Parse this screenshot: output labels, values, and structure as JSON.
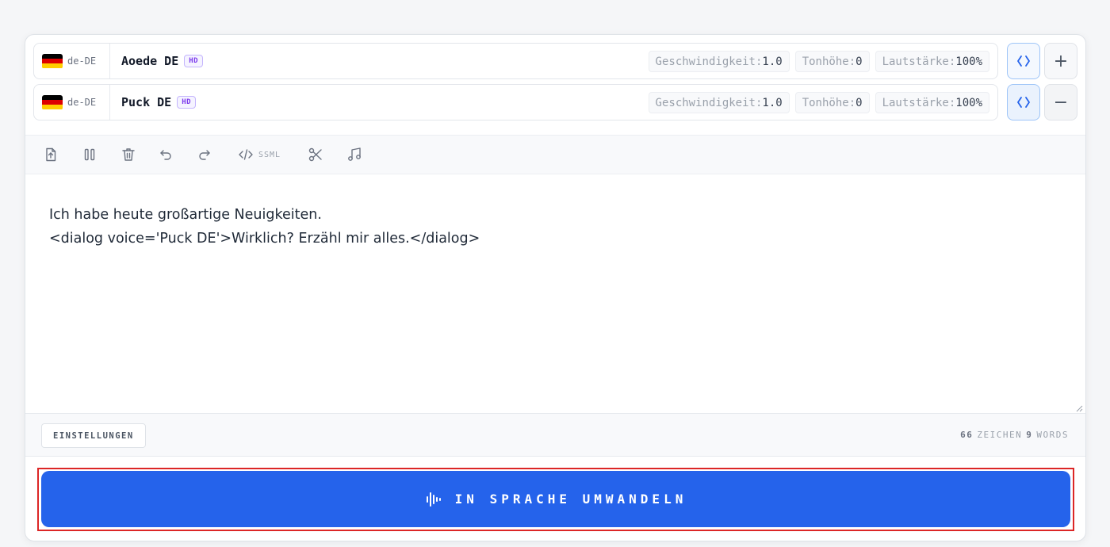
{
  "voices": [
    {
      "lang": "de-DE",
      "name": "Aoede DE",
      "badge": "HD",
      "speed_label": "Geschwindigkeit:",
      "speed_value": "1.0",
      "pitch_label": "Tonhöhe:",
      "pitch_value": "0",
      "volume_label": "Lautstärke:",
      "volume_value": "100%",
      "action": "+"
    },
    {
      "lang": "de-DE",
      "name": "Puck DE",
      "badge": "HD",
      "speed_label": "Geschwindigkeit:",
      "speed_value": "1.0",
      "pitch_label": "Tonhöhe:",
      "pitch_value": "0",
      "volume_label": "Lautstärke:",
      "volume_value": "100%",
      "action": "−"
    }
  ],
  "toolbar": {
    "ssml_label": "SSML",
    "icons": [
      "upload-icon",
      "pause-icon",
      "trash-icon",
      "undo-icon",
      "redo-icon",
      "code-icon",
      "scissors-icon",
      "music-icon"
    ]
  },
  "editor": {
    "text": "Ich habe heute großartige Neuigkeiten.\n<dialog voice='Puck DE'>Wirklich? Erzähl mir alles.</dialog>"
  },
  "footer": {
    "settings_label": "EINSTELLUNGEN",
    "char_count": "66",
    "char_label": "ZEICHEN",
    "word_count": "9",
    "word_label": "WORDS"
  },
  "convert": {
    "label": "IN SPRACHE UMWANDELN"
  },
  "colors": {
    "accent": "#2563eb",
    "focus": "#dc2626",
    "hd_badge": "#7c3aed"
  }
}
